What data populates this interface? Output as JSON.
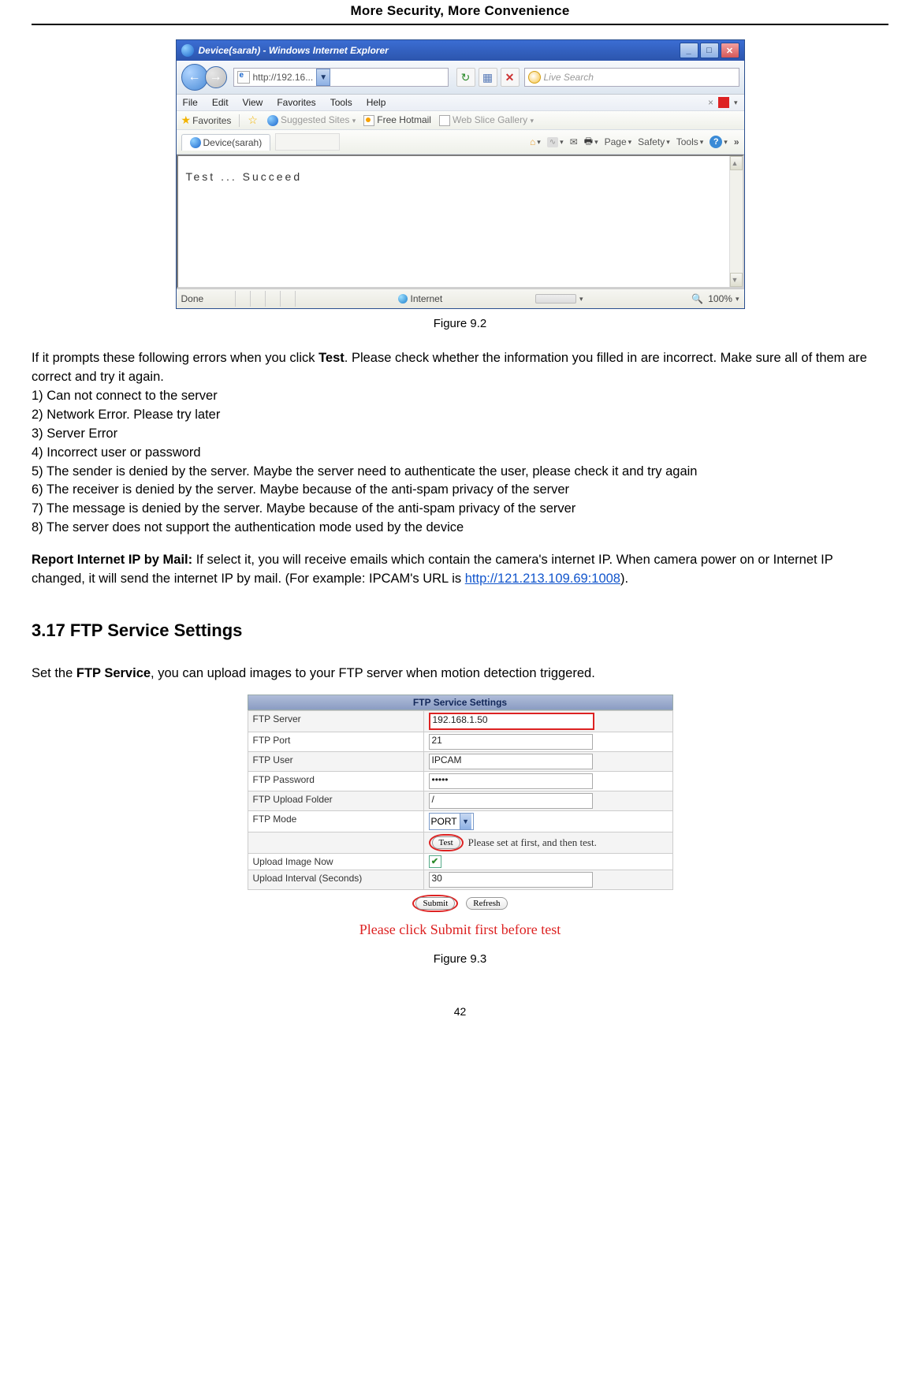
{
  "header": "More Security, More Convenience",
  "ie": {
    "title": "Device(sarah) - Windows Internet Explorer",
    "addr": "http://192.16...",
    "search_placeholder": "Live Search",
    "menu": [
      "File",
      "Edit",
      "View",
      "Favorites",
      "Tools",
      "Help"
    ],
    "close_x": "×",
    "favorites_label": "Favorites",
    "suggested_sites": "Suggested Sites",
    "free_hotmail": "Free Hotmail",
    "web_slice": "Web Slice Gallery",
    "tab_title": "Device(sarah)",
    "toolbar": {
      "page": "Page",
      "safety": "Safety",
      "tools": "Tools"
    },
    "content": "Test ... Succeed",
    "status_done": "Done",
    "status_internet": "Internet",
    "zoom": "100%"
  },
  "fig92": "Figure 9.2",
  "para1a": "If it prompts these following errors when you click ",
  "para1_test": "Test",
  "para1b": ". Please check whether the information you filled in are incorrect. Make sure all of them are correct and try it again.",
  "errs": [
    "1) Can not connect to the server",
    "2) Network Error. Please try later",
    "3) Server Error",
    "4) Incorrect user or password",
    "5) The sender is denied by the server. Maybe the server need to authenticate the user, please check it and try again",
    "6) The receiver is denied by the server. Maybe because of the anti-spam privacy of the server",
    "7) The message is denied by the server. Maybe because of the anti-spam privacy of the server",
    "8) The server does not support the authentication mode used by the device"
  ],
  "report_label": "Report Internet IP by Mail:",
  "report_text_a": " If select it, you will receive emails which contain the camera's internet IP. When camera power on or Internet IP changed, it will send the internet IP by mail. (For example: IPCAM's URL is ",
  "report_link": "http://121.213.109.69:1008",
  "report_text_b": ").",
  "section317": "3.17 FTP Service Settings",
  "ftp_intro_a": "Set the ",
  "ftp_intro_bold": "FTP Service",
  "ftp_intro_b": ", you can upload images to your FTP server when motion detection triggered.",
  "ftp": {
    "title": "FTP Service Settings",
    "rows": {
      "server_label": "FTP Server",
      "server_val": "192.168.1.50",
      "port_label": "FTP Port",
      "port_val": "21",
      "user_label": "FTP User",
      "user_val": "IPCAM",
      "pass_label": "FTP Password",
      "pass_val": "•••••",
      "folder_label": "FTP Upload Folder",
      "folder_val": "/",
      "mode_label": "FTP Mode",
      "mode_val": "PORT",
      "test_btn": "Test",
      "test_hint": "Please set at first, and then test.",
      "upload_now_label": "Upload Image Now",
      "interval_label": "Upload Interval (Seconds)",
      "interval_val": "30"
    },
    "submit": "Submit",
    "refresh": "Refresh",
    "note": "Please click Submit first before test"
  },
  "fig93": "Figure 9.3",
  "page_num": "42"
}
